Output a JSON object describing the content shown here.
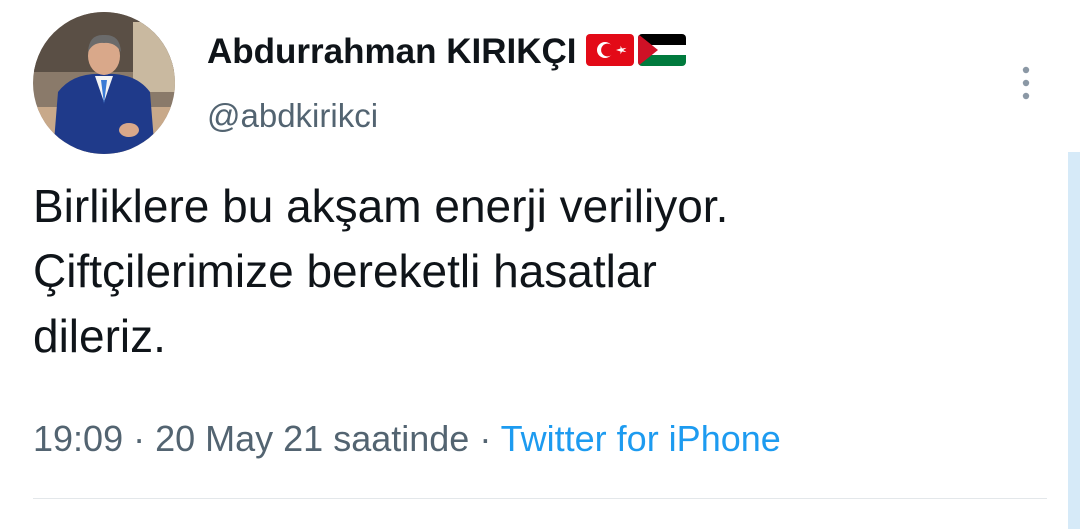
{
  "author": {
    "display_name": "Abdurrahman KIRIKÇI",
    "handle": "@abdkirikci",
    "avatar_icon": "profile-photo",
    "flags": [
      "turkey-flag-icon",
      "palestine-flag-icon"
    ]
  },
  "tweet": {
    "text_lines": [
      "Birliklere bu akşam enerji veriliyor.",
      "Çiftçilerimize bereketli hasatlar",
      "dileriz."
    ],
    "time": "19:09",
    "separator": " · ",
    "date_label": "20 May 21 saatinde",
    "source": "Twitter for iPhone"
  },
  "colors": {
    "text_primary": "#0f1419",
    "text_secondary": "#536471",
    "link": "#1d9bf0",
    "turkey_red": "#e30a17",
    "palestine_green": "#007a3d",
    "palestine_red": "#ce1126"
  }
}
